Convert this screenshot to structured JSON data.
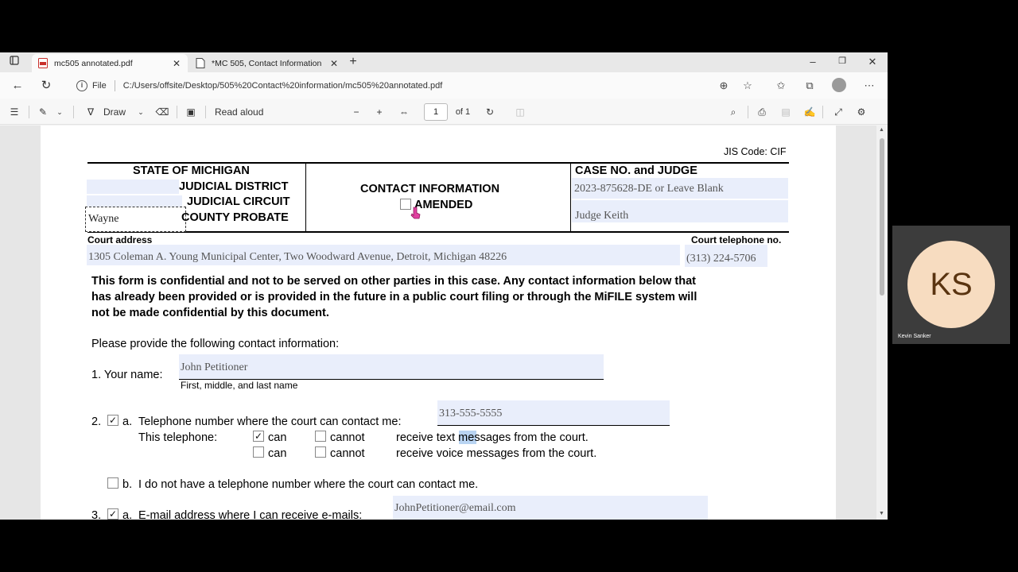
{
  "browser": {
    "tabs": [
      {
        "label": "mc505 annotated.pdf",
        "active": true
      },
      {
        "label": "*MC 505, Contact Information",
        "active": false
      }
    ],
    "address": {
      "scheme_label": "File",
      "url": "C:/Users/offsite/Desktop/505%20Contact%20information/mc505%20annotated.pdf"
    }
  },
  "pdf_toolbar": {
    "draw_label": "Draw",
    "read_aloud_label": "Read aloud",
    "page_value": "1",
    "page_total": "of 1"
  },
  "form": {
    "jis_code": "JIS Code: CIF",
    "header_left": {
      "state": "STATE OF MICHIGAN",
      "district": "JUDICIAL DISTRICT",
      "circuit": "JUDICIAL CIRCUIT",
      "probate": "COUNTY PROBATE",
      "county_value": "Wayne"
    },
    "header_center": {
      "title": "CONTACT INFORMATION",
      "amended": "AMENDED"
    },
    "header_right": {
      "title": "CASE NO. and JUDGE",
      "case_value": "2023-875628-DE or Leave Blank",
      "judge_value": "Judge Keith"
    },
    "court_address_label": "Court address",
    "court_address_value": "1305 Coleman A. Young Municipal Center, Two Woodward Avenue, Detroit, Michigan 48226",
    "court_phone_label": "Court telephone no.",
    "court_phone_value": "(313) 224-5706",
    "notice": [
      "This form is confidential and not to be served on other parties in this case.  Any contact information below that",
      "has already been provided or is provided in the future in a public court filing or through the MiFILE system will",
      "not be made confidential by this document."
    ],
    "intro": "Please provide the following contact information:",
    "item1": {
      "label": "1.  Your name:",
      "value": "John Petitioner",
      "hint": "First, middle, and last name"
    },
    "item2a": {
      "num": "2.",
      "sub": "a.",
      "label": "Telephone number where the court can contact me:",
      "value": "313-555-5555",
      "this_phone": "This telephone:",
      "can": "can",
      "cannot": "cannot",
      "text_line": "receive text messages from the court.",
      "voice_line": "receive voice messages from the court."
    },
    "item2b": {
      "sub": "b.",
      "label": "I do not have a telephone number where the court can contact me."
    },
    "item3a": {
      "num": "3.",
      "sub": "a.",
      "label": "E-mail address where I can receive e-mails:",
      "value": "JohnPetitioner@email.com"
    }
  },
  "webcam": {
    "initials": "KS",
    "name": "Kevin Sanker"
  }
}
